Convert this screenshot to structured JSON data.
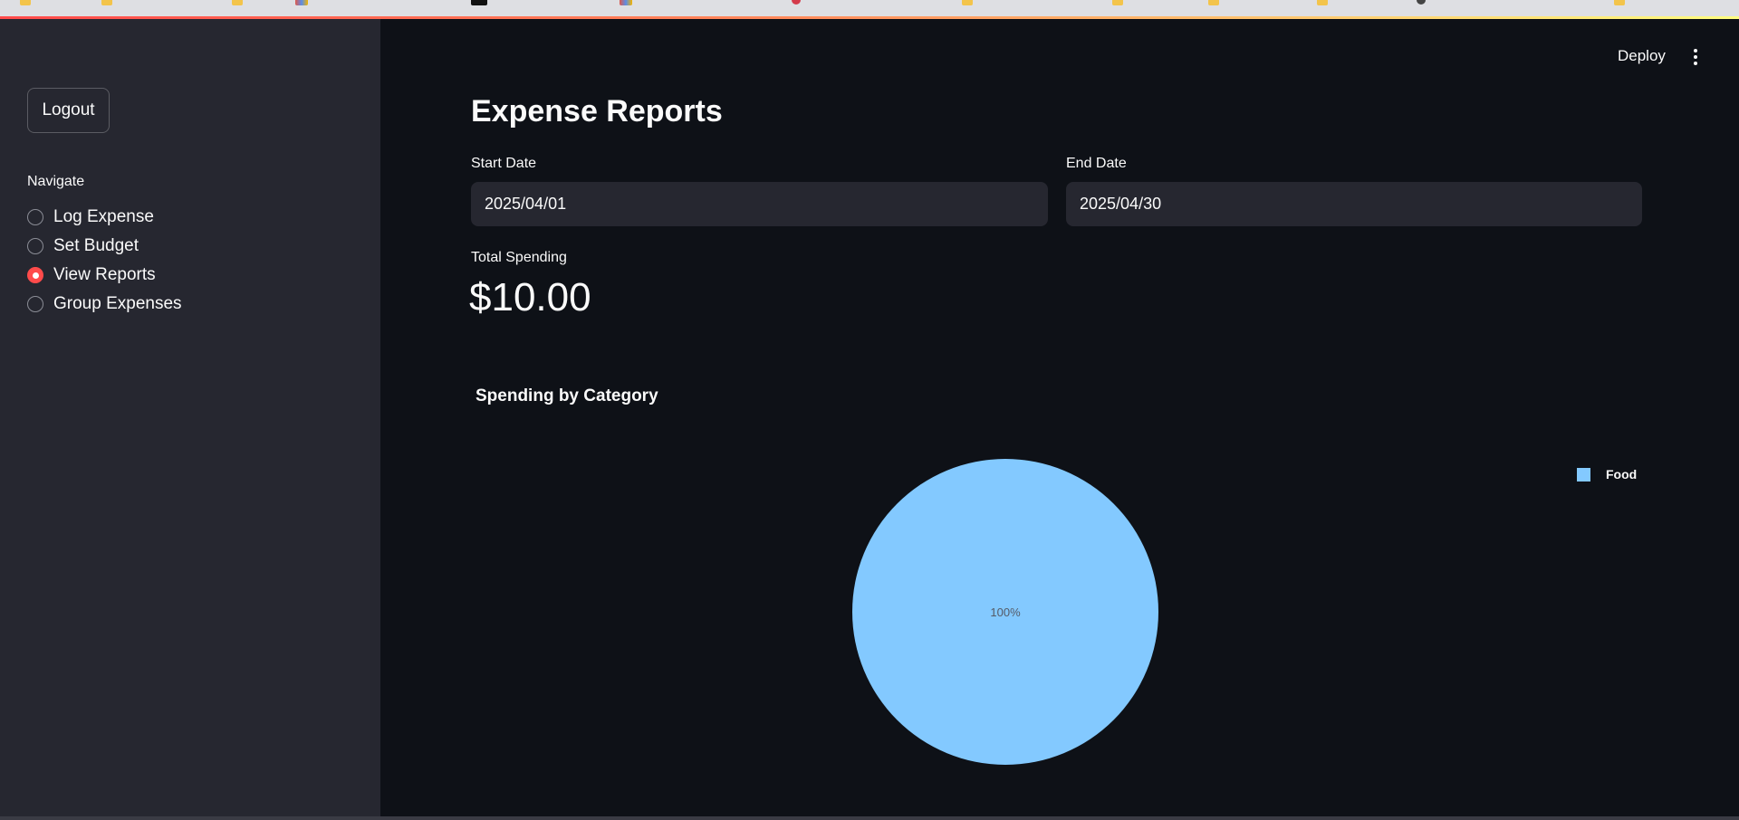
{
  "sidebar": {
    "logout_label": "Logout",
    "nav_label": "Navigate",
    "items": [
      {
        "label": "Log Expense",
        "selected": false
      },
      {
        "label": "Set Budget",
        "selected": false
      },
      {
        "label": "View Reports",
        "selected": true
      },
      {
        "label": "Group Expenses",
        "selected": false
      }
    ]
  },
  "header": {
    "deploy_label": "Deploy",
    "menu_icon": "more-vert-icon"
  },
  "main": {
    "title": "Expense Reports",
    "start_date": {
      "label": "Start Date",
      "value": "2025/04/01"
    },
    "end_date": {
      "label": "End Date",
      "value": "2025/04/30"
    },
    "metric": {
      "label": "Total Spending",
      "value": "$10.00"
    },
    "chart_title": "Spending by Category"
  },
  "colors": {
    "accent": "#ff4b4b",
    "background": "#0e1117",
    "sidebar": "#262730",
    "pie_food": "#83c9ff"
  },
  "chart_data": {
    "type": "pie",
    "title": "Spending by Category",
    "categories": [
      "Food"
    ],
    "values": [
      100
    ],
    "labels": [
      "100%"
    ],
    "legend": "top-right"
  }
}
